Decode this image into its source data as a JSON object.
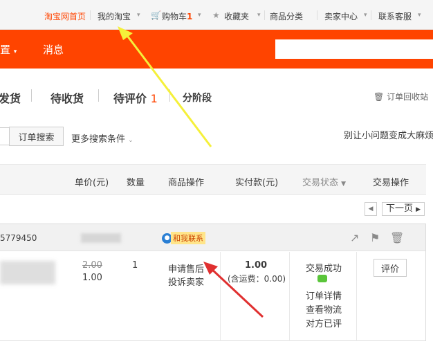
{
  "topbar": {
    "home": "淘宝网首页",
    "my_taobao": "我的淘宝",
    "cart_label": "购物车",
    "cart_count": "1",
    "favorites": "收藏夹",
    "categories": "商品分类",
    "seller_center": "卖家中心",
    "contact_service": "联系客服"
  },
  "orangebar": {
    "settings": "置",
    "messages": "消息",
    "accent": "#ff4400"
  },
  "tabs": {
    "to_ship": "发货",
    "to_receive": "待收货",
    "to_review": "待评价",
    "to_review_count": "1",
    "installment": "分阶段",
    "recycle_bin": "订单回收站"
  },
  "search": {
    "order_search": "订单搜索",
    "more_conditions": "更多搜索条件",
    "promo": "别让小问题变成大麻烦"
  },
  "table_header": {
    "unit_price": "单价(元)",
    "quantity": "数量",
    "product_ops": "商品操作",
    "paid": "实付款(元)",
    "status": "交易状态",
    "trade_ops": "交易操作"
  },
  "pager": {
    "next": "下一页"
  },
  "order": {
    "id_partial": "5779450",
    "chat_label": "和我联系",
    "original_price": "2.00",
    "price": "1.00",
    "quantity": "1",
    "after_sale": "申请售后",
    "complain": "投诉卖家",
    "paid": "1.00",
    "shipping": "(含运费：0.00)",
    "status": "交易成功",
    "detail": "订单详情",
    "logistics": "查看物流",
    "reviewed": "对方已评",
    "review_btn": "评价"
  },
  "colors": {
    "highlight": "#ff4400",
    "yellow_arrow": "#f5f03a",
    "red_arrow": "#e03030"
  }
}
